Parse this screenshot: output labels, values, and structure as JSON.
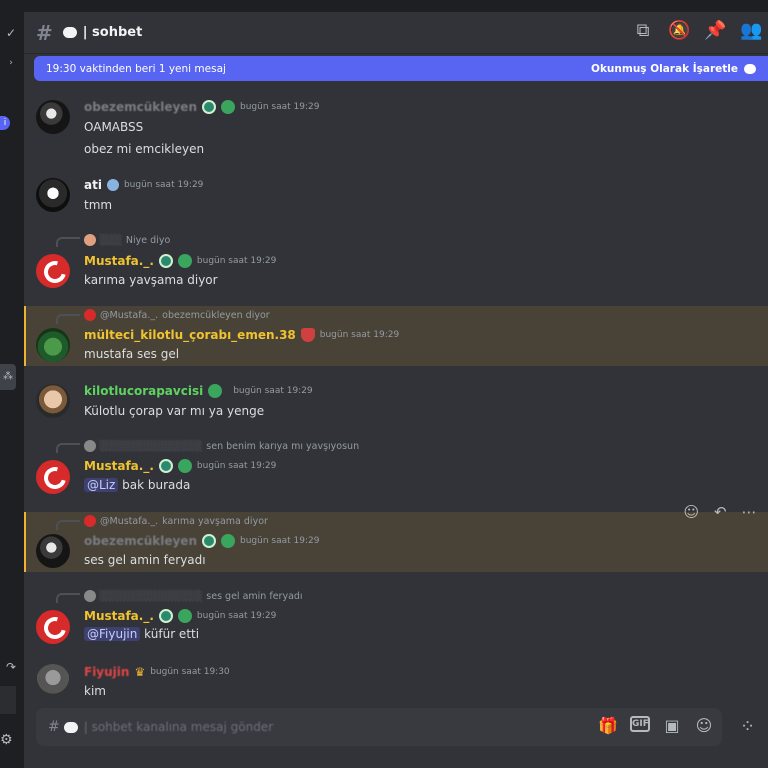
{
  "channel": {
    "name": "| sohbet",
    "new_messages_text": "19:30 vaktinden beri 1 yeni mesaj",
    "mark_read_text": "Okunmuş Olarak İşaretle"
  },
  "header_icons": [
    "threads-icon",
    "mute-icon",
    "pin-icon",
    "members-icon"
  ],
  "messages": [
    {
      "author": "obezemcükleyen",
      "time": "bugün saat 19:29",
      "lines": [
        "OAMABSS",
        "obez mi emcikleyen"
      ]
    },
    {
      "author": "ati",
      "time": "bugün saat 19:29",
      "lines": [
        "tmm"
      ]
    },
    {
      "reply_text": "Niye diyo",
      "author": "Mustafa._.",
      "time": "bugün saat 19:29",
      "lines": [
        "karıma yavşama diyor"
      ]
    },
    {
      "reply_author": "@Mustafa._.",
      "reply_text": "obezemcükleyen diyor",
      "author": "mülteci_kilotlu_çorabı_emen.38",
      "time": "bugün saat 19:29",
      "lines": [
        "mustafa ses gel"
      ]
    },
    {
      "author": "kilotlucorapavcisi",
      "time": "bugün saat 19:29",
      "lines": [
        "Külotlu çorap var mı ya yenge"
      ]
    },
    {
      "reply_text": "sen benim karıya mı yavşıyosun",
      "author": "Mustafa._.",
      "time": "bugün saat 19:29",
      "mention": "@Liz",
      "text_after": "bak burada"
    },
    {
      "reply_author": "@Mustafa._.",
      "reply_text": "karıma yavşama diyor",
      "author": "obezemcükleyen",
      "time": "bugün saat 19:29",
      "lines": [
        "ses gel amin feryadı"
      ]
    },
    {
      "reply_text": "ses gel amin feryadı",
      "author": "Mustafa._.",
      "time": "bugün saat 19:29",
      "mention": "@Fiyujin",
      "text_after": "küfür etti"
    },
    {
      "author": "Fiyujin",
      "time": "bugün saat 19:30",
      "lines": [
        "kim"
      ]
    }
  ],
  "composer": {
    "placeholder": "| sohbet kanalına mesaj gönder",
    "gif_label": "GIF"
  }
}
